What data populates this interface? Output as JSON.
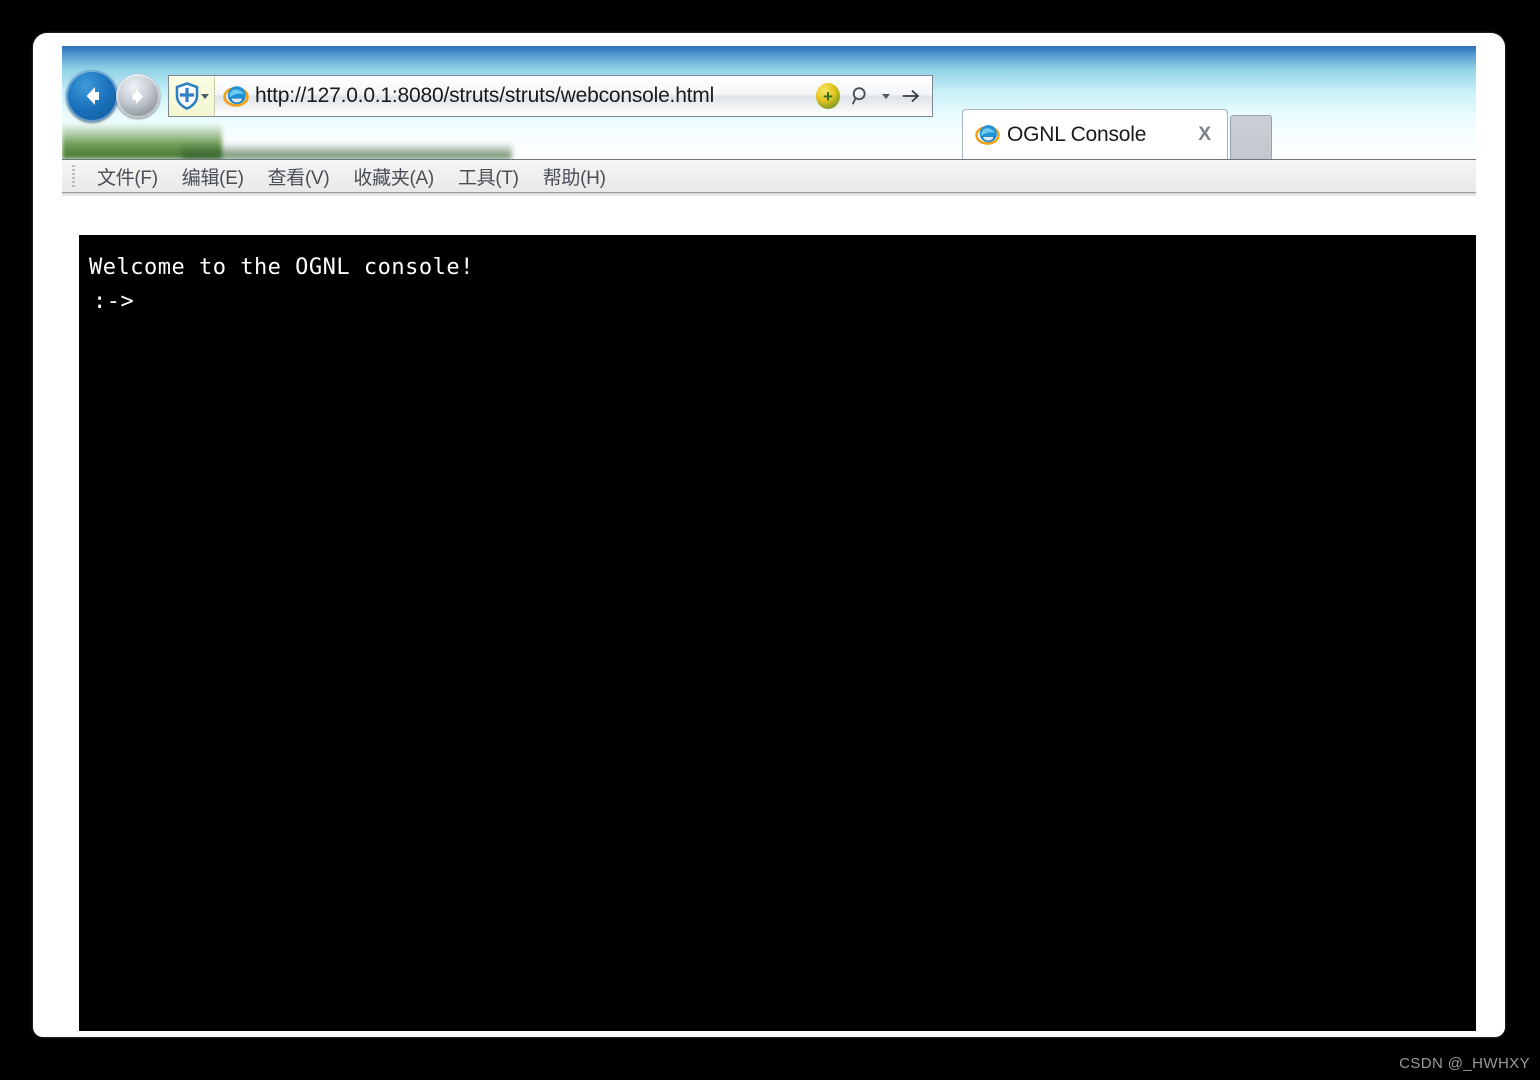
{
  "window": {
    "nav": {
      "back_label": "Back",
      "forward_label": "Forward",
      "back_icon": "arrow-left-icon",
      "forward_icon": "arrow-right-icon"
    },
    "address_bar": {
      "url": "http://127.0.0.1:8080/struts/struts/webconsole.html",
      "placeholder": "",
      "compat_view_icon": "shield-plus-icon",
      "site_icon": "internet-explorer-icon",
      "compat_indicator_icon": "compatibility-view-icon",
      "compat_indicator_glyph": "+",
      "search_icon": "magnifier-icon",
      "dropdown_icon": "chevron-down-icon",
      "go_icon": "arrow-right-go-icon"
    },
    "tabs": [
      {
        "label": "OGNL Console",
        "favicon": "internet-explorer-icon",
        "close_label": "X",
        "active": true
      }
    ],
    "new_tab_label": ""
  },
  "menu_bar": {
    "items": [
      {
        "label": "文件(F)"
      },
      {
        "label": "编辑(E)"
      },
      {
        "label": "查看(V)"
      },
      {
        "label": "收藏夹(A)"
      },
      {
        "label": "工具(T)"
      },
      {
        "label": "帮助(H)"
      }
    ]
  },
  "console": {
    "welcome_line": "Welcome to the OGNL console!",
    "prompt_line": ":->",
    "background_color": "#000000",
    "text_color": "#ffffff"
  },
  "watermark": {
    "text": "CSDN @_HWHXY"
  }
}
